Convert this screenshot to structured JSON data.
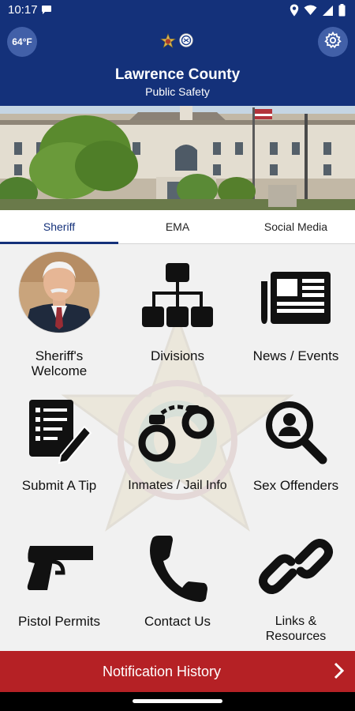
{
  "status_bar": {
    "time": "10:17"
  },
  "header": {
    "temperature": "64°F",
    "title": "Lawrence County",
    "subtitle": "Public Safety"
  },
  "tabs": [
    {
      "label": "Sheriff",
      "active": true
    },
    {
      "label": "EMA",
      "active": false
    },
    {
      "label": "Social Media",
      "active": false
    }
  ],
  "tiles": [
    {
      "label": "Sheriff's\nWelcome",
      "icon": "sheriff-portrait"
    },
    {
      "label": "Divisions",
      "icon": "org-chart-icon"
    },
    {
      "label": "News / Events",
      "icon": "newspaper-icon"
    },
    {
      "label": "Submit A Tip",
      "icon": "document-pen-icon"
    },
    {
      "label": "Inmates / Jail Info",
      "icon": "handcuffs-icon"
    },
    {
      "label": "Sex Offenders",
      "icon": "person-search-icon"
    },
    {
      "label": "Pistol Permits",
      "icon": "pistol-icon"
    },
    {
      "label": "Contact Us",
      "icon": "phone-icon"
    },
    {
      "label": "Links &\nResources",
      "icon": "link-icon"
    }
  ],
  "footer": {
    "notification_label": "Notification History"
  },
  "colors": {
    "primary": "#14317a",
    "accent": "#b52125",
    "background": "#f1f1f1"
  }
}
